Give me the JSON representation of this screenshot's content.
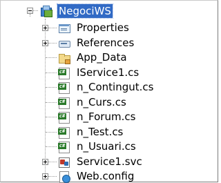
{
  "tree": {
    "root": {
      "label": "NegociWS",
      "icon": "web-project-icon",
      "expanded": true,
      "selected": true
    },
    "items": [
      {
        "label": "Properties",
        "icon": "properties-icon",
        "expandable": true
      },
      {
        "label": "References",
        "icon": "references-icon",
        "expandable": true
      },
      {
        "label": "App_Data",
        "icon": "folder-icon",
        "expandable": false
      },
      {
        "label": "IService1.cs",
        "icon": "csharp-file-icon",
        "expandable": false
      },
      {
        "label": "n_Contingut.cs",
        "icon": "csharp-file-icon",
        "expandable": false
      },
      {
        "label": "n_Curs.cs",
        "icon": "csharp-file-icon",
        "expandable": false
      },
      {
        "label": "n_Forum.cs",
        "icon": "csharp-file-icon",
        "expandable": false
      },
      {
        "label": "n_Test.cs",
        "icon": "csharp-file-icon",
        "expandable": false
      },
      {
        "label": "n_Usuari.cs",
        "icon": "csharp-file-icon",
        "expandable": false
      },
      {
        "label": "Service1.svc",
        "icon": "service-file-icon",
        "expandable": true
      },
      {
        "label": "Web.config",
        "icon": "config-file-icon",
        "expandable": true
      }
    ],
    "colors": {
      "selection": "#316ac5",
      "selection_text": "#ffffff",
      "lines": "#9a9a9a"
    },
    "csharp_badge": "c#"
  }
}
